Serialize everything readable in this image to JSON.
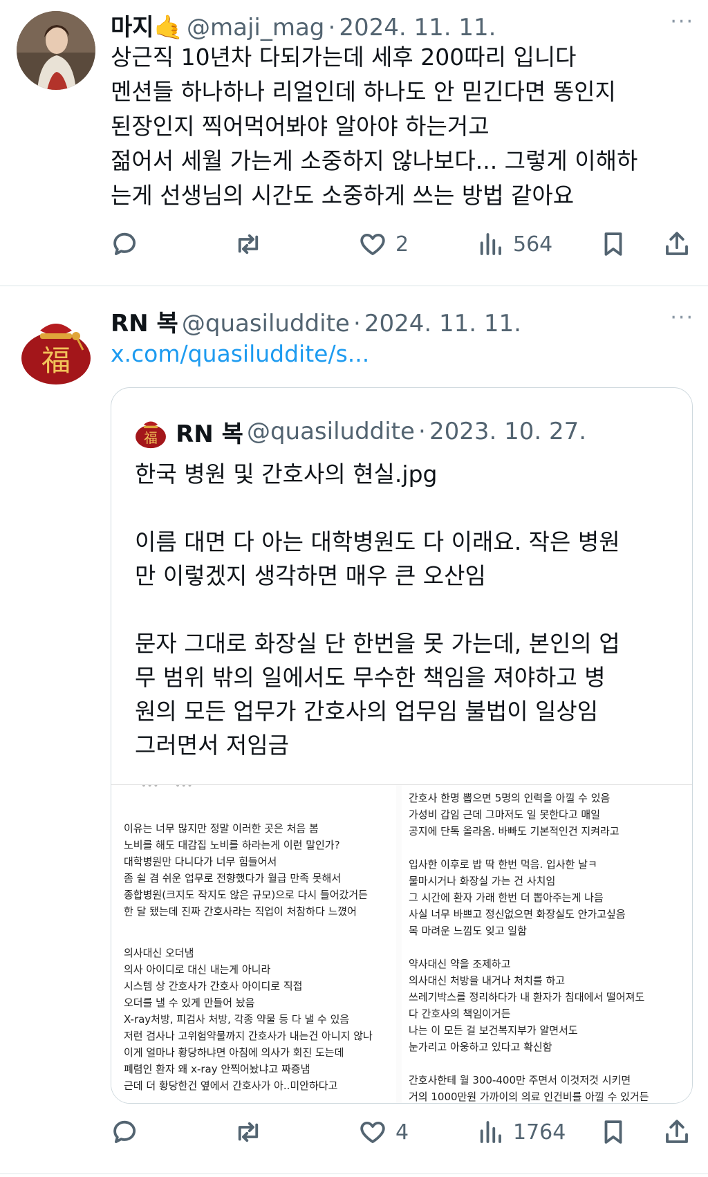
{
  "tweet1": {
    "name": "마지🤙",
    "handle": "@maji_mag",
    "dot": "·",
    "date": "2024. 11. 11.",
    "more": "···",
    "text_lines": [
      "상근직 10년차 다되가는데 세후 200따리 입니다",
      "멘션들 하나하나 리얼인데 하나도 안 믿긴다면 똥인지",
      "된장인지 찍어먹어봐야 알아야 하는거고",
      "젊어서 세월 가는게 소중하지 않나보다... 그렇게 이해하",
      "는게 선생님의 시간도 소중하게 쓰는 방법 같아요"
    ],
    "actions": {
      "likes": "2",
      "views": "564"
    }
  },
  "tweet2": {
    "name": "RN 복",
    "handle": "@quasiluddite",
    "dot": "·",
    "date": "2024. 11. 11.",
    "more": "···",
    "link": "x.com/quasiluddite/s...",
    "avatar_glyph": "福",
    "actions": {
      "likes": "4",
      "views": "1764"
    }
  },
  "quote": {
    "name": "RN 복",
    "handle": "@quasiluddite",
    "dot": "·",
    "date": "2023. 10. 27.",
    "avatar_glyph": "福",
    "text": "한국 병원 및 간호사의 현실.jpg\n\n이름 대면 다 아는 대학병원도 다 이래요. 작은 병원\n만 이렇겠지 생각하면 매우 큰 오산임\n\n문자 그대로 화장실 단 한번을 못 가는데, 본인의 업\n무 범위 밖의 일에서도 무수한 책임을 져야하고 병\n원의 모든 업무가 간호사의 업무임 불법이 일상임\n그러면서 저임금",
    "image_left_lines": [
      "이유는 너무 많지만 정말 이러한 곳은 처음 봄",
      "노비를 해도 대감집 노비를 하라는게 이런 말인가?",
      "대학병원만 다니다가 너무 힘들어서",
      "좀 쉴 겸 쉬운 업무로 전향했다가 월급 만족 못해서",
      "종합병원(크지도 작지도 않은 규모)으로 다시 들어갔거든",
      "한 달 됐는데 진짜 간호사라는 직업이 처참하다 느꼈어",
      "의사대신 오더냄",
      "의사 아이디로 대신 내는게 아니라",
      "시스템 상 간호사가 간호사 아이디로 직접",
      "오더를 낼 수 있게 만들어 놨음",
      "X-ray처방, 피검사 처방, 각종 약물 등 다 낼 수 있음",
      "저런 검사나 고위험약물까지 간호사가 내는건 아니지 않나",
      "이게 얼마나 황당하냐면 아침에 의사가 회진 도는데",
      "폐렴인 환자 왜 x-ray 안찍어놨냐고 짜증냄",
      "근데 더 황당한건 옆에서 간호사가 아..미안하다고"
    ],
    "image_right_lines": [
      "간호사 한명 뽑으면 5명의 인력을 아낄 수 있음",
      "가성비 갑임 근데 그마저도 일 못한다고 매일",
      "공지에 단톡 올라옴. 바빠도 기본적인건 지켜라고",
      "입사한 이후로 밥 딱 한번 먹음. 입사한 날ㅋ",
      "물마시거나 화장실 가는 건 사치임",
      "그 시간에 환자 가래 한번 더 뽑아주는게 나음",
      "사실 너무 바쁘고 정신없으면 화장실도 안가고싶음",
      "목 마려운 느낌도 잊고 일함",
      "약사대신 약을 조제하고",
      "의사대신 처방을 내거나 처치를 하고",
      "쓰레기박스를 정리하다가 내 환자가 침대에서 떨어져도",
      "다 간호사의 책임이거든",
      "나는 이 모든 걸 보건복지부가 알면서도",
      "눈가리고 아웅하고 있다고 확신함",
      "간호사한테 월 300-400만 주면서 이것저것 시키면",
      "거의 1000만원 가까이의 의료 인건비를 아낄 수 있거든"
    ]
  }
}
